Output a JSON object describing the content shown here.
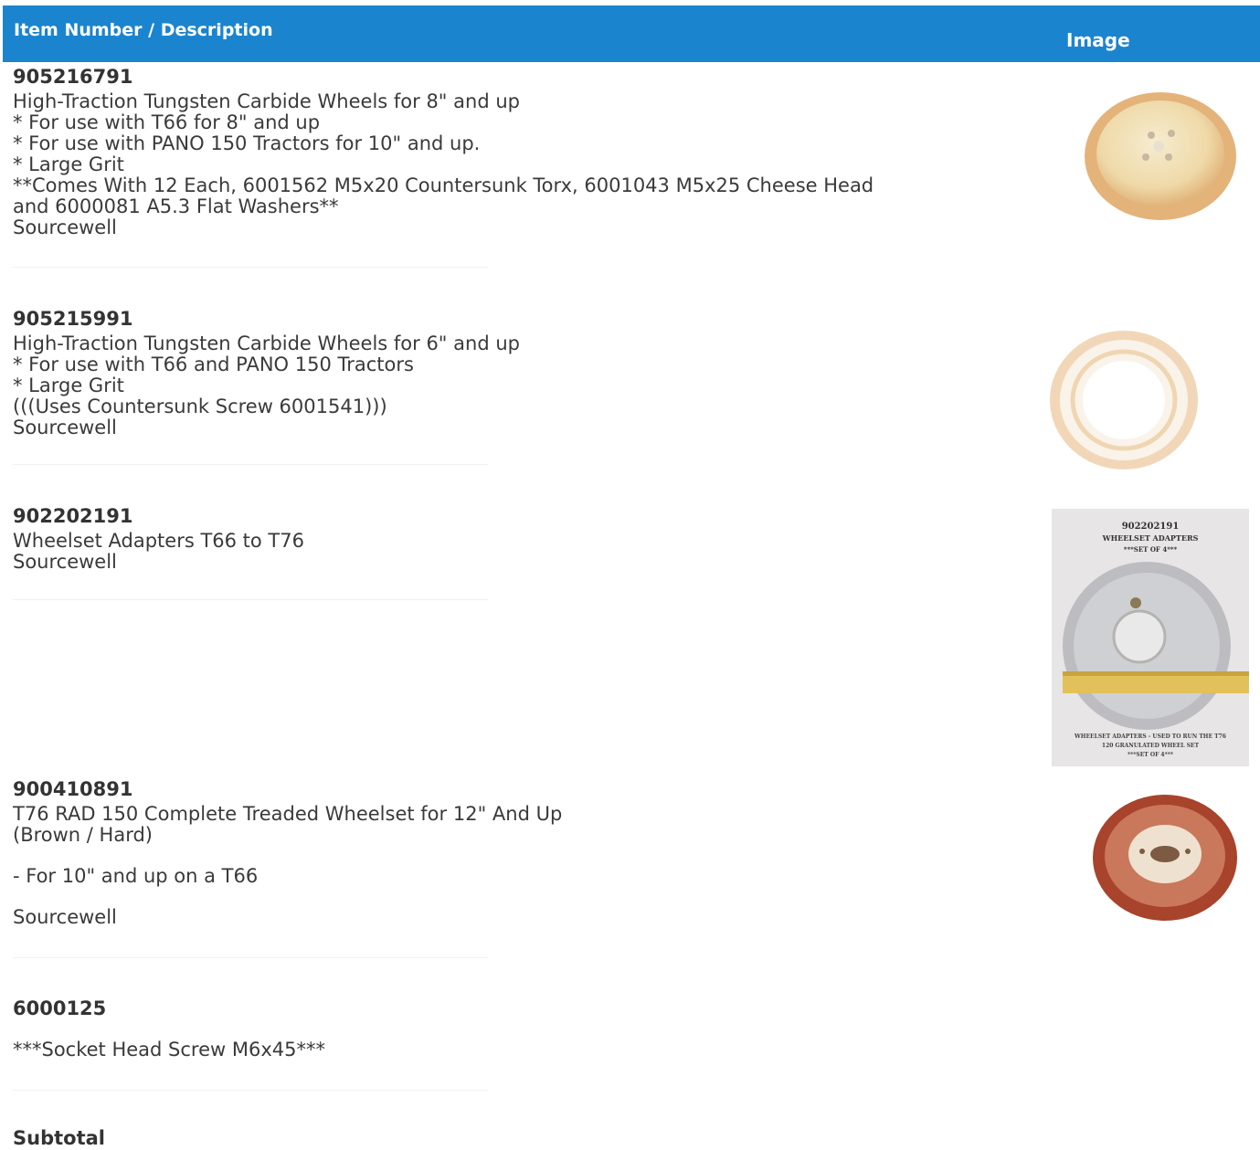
{
  "header": {
    "description_col": "Item Number / Description",
    "image_col": "Image",
    "background": "#1b84cf"
  },
  "items": [
    {
      "number": "905216791",
      "lines": [
        "High-Traction Tungsten Carbide Wheels for 8\" and up",
        "* For use with T66 for 8\" and up",
        "* For use with PANO 150 Tractors for 10\" and up.",
        "* Large Grit",
        "**Comes With 12 Each, 6001562 M5x20 Countersunk Torx, 6001043 M5x25 Cheese Head",
        "and 6000081 A5.3 Flat Washers**",
        "Sourcewell"
      ],
      "image": "carbide-wheel-8in"
    },
    {
      "number": "905215991",
      "lines": [
        "High-Traction Tungsten Carbide Wheels for 6\" and up",
        "* For use with T66 and PANO 150 Tractors",
        "* Large Grit",
        "(((Uses Countersunk Screw 6001541)))",
        "Sourcewell"
      ],
      "image": "carbide-wheel-6in"
    },
    {
      "number": "902202191",
      "lines": [
        "Wheelset Adapters T66 to T76",
        "Sourcewell"
      ],
      "image": "wheelset-adapters",
      "image_text": {
        "top1": "902202191",
        "top2": "WHEELSET ADAPTERS",
        "top3": "***SET OF 4***",
        "bottom1": "WHEELSET ADAPTERS - USED TO RUN THE T76",
        "bottom2": "120 GRANULATED WHEEL SET",
        "bottom3": "***SET OF 4***"
      }
    },
    {
      "number": "900410891",
      "lines": [
        "T76 RAD 150 Complete Treaded Wheelset for 12\" And Up",
        "(Brown / Hard)",
        "- For 10\" and up on a T66",
        "Sourcewell"
      ],
      "image": "treaded-wheelset-brown"
    },
    {
      "number": "6000125",
      "lines": [
        "***Socket Head Screw M6x45***"
      ],
      "image": ""
    }
  ],
  "footer": {
    "subtotal_label": "Subtotal"
  }
}
